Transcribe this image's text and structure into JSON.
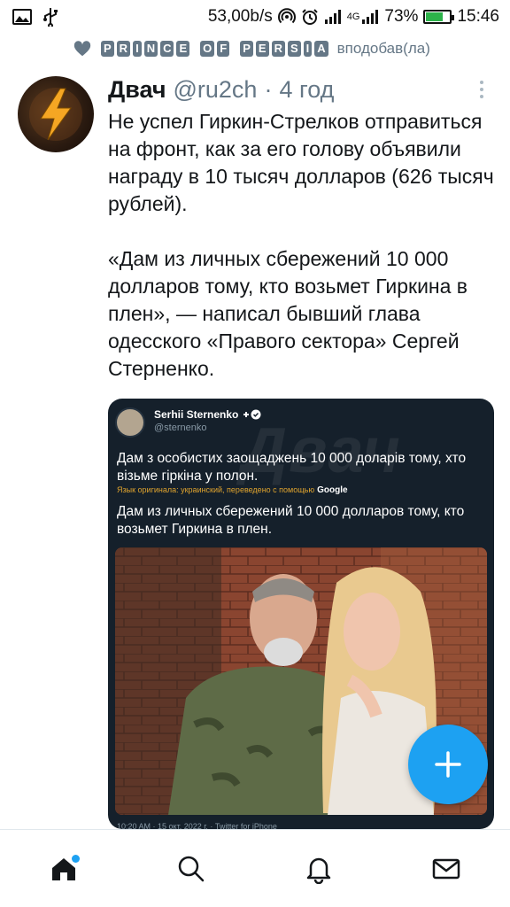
{
  "status_bar": {
    "net_speed": "53,00b/s",
    "network_type": "4G",
    "battery": "73%",
    "battery_level": 0.73,
    "time": "15:46",
    "icons": [
      "image-icon",
      "usb-icon",
      "hotspot-icon",
      "alarm-icon",
      "signal-icon",
      "signal-4g-icon",
      "battery-icon"
    ]
  },
  "liked_by": {
    "name": "PRINCE OF PERSIA",
    "action": "вподобав(ла)"
  },
  "tweet": {
    "author_name": "Двач",
    "handle": "@ru2ch",
    "separator": "·",
    "time": "4 год",
    "text_p1": "Не успел Гиркин-Стрелков отправиться на фронт, как за его голову объявили награду в 10 тысяч долларов (626 тысяч рублей).",
    "text_p2": "«Дам из личных сбережений 10 000 долларов тому, кто возьмет Гиркина в плен», — написал бывший глава одесского «Правого сектора» Сергей Стерненко."
  },
  "embedded": {
    "name": "Serhii Sternenko",
    "handle": "@sternenko",
    "text_ua": "Дам з особистих заощаджень 10 000 доларів тому, хто візьме гіркіна у полон.",
    "translate_note": "Язык оригинала: украинский, переведено с помощью",
    "translate_brand": "Google",
    "text_ru": "Дам из личных сбережений 10 000 долларов тому, кто возьмет Гиркина в плен.",
    "footer": "10:20 AM · 15 окт. 2022 г. · Twitter for iPhone",
    "watermark": "Двач"
  },
  "colors": {
    "accent": "#1da1f2",
    "text": "#14171a",
    "muted": "#657786",
    "embed_bg": "#15202b"
  },
  "nav": {
    "items": [
      "home-icon",
      "search-icon",
      "notifications-icon",
      "messages-icon"
    ]
  }
}
